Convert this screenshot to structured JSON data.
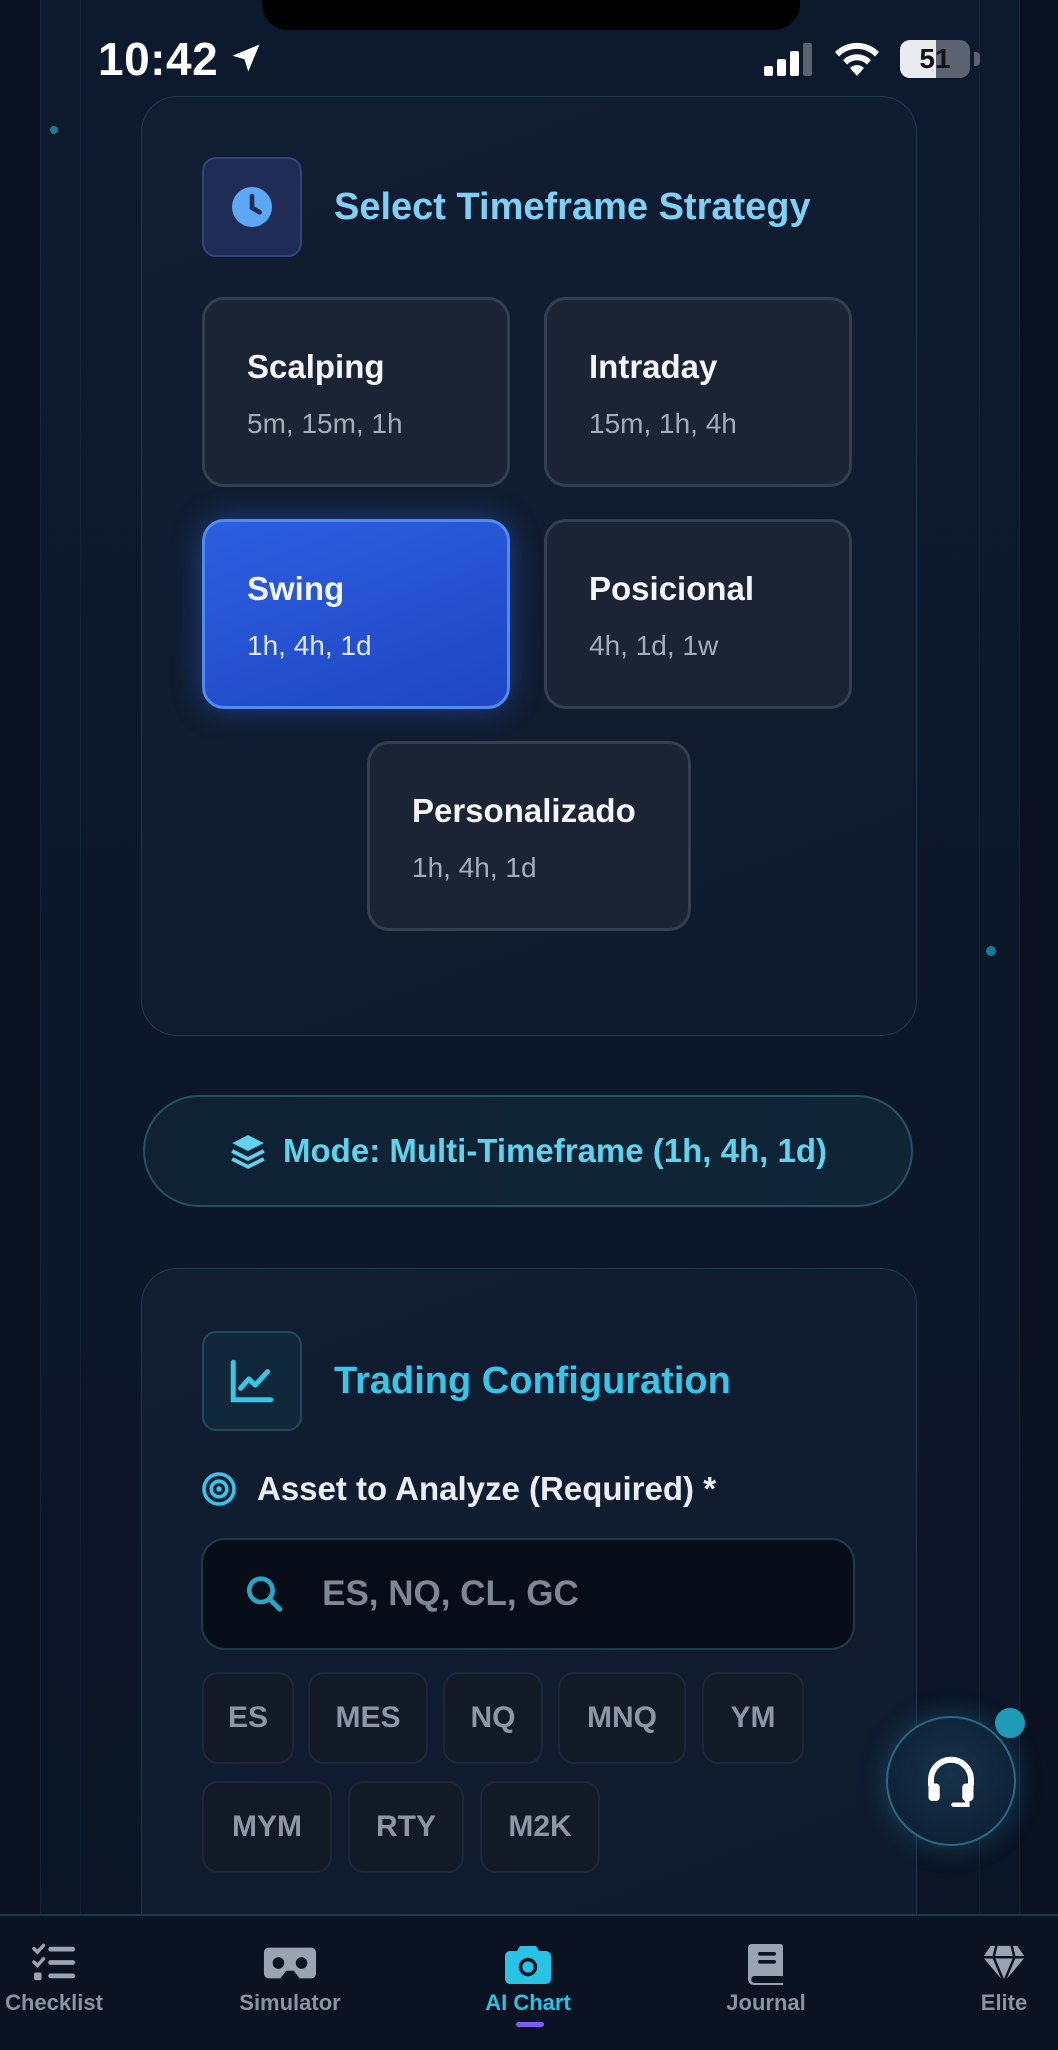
{
  "status_bar": {
    "time": "10:42",
    "battery": "51",
    "battery_level": 0.51
  },
  "timeframe": {
    "title": "Select Timeframe Strategy",
    "options": [
      {
        "name": "Scalping",
        "frames": "5m, 15m, 1h"
      },
      {
        "name": "Intraday",
        "frames": "15m, 1h, 4h"
      },
      {
        "name": "Swing",
        "frames": "1h, 4h, 1d"
      },
      {
        "name": "Posicional",
        "frames": "4h, 1d, 1w"
      },
      {
        "name": "Personalizado",
        "frames": "1h, 4h, 1d"
      }
    ],
    "selected": "Swing"
  },
  "mode": {
    "label": "Mode: Multi-Timeframe (1h, 4h, 1d)"
  },
  "config": {
    "title": "Trading Configuration",
    "asset_label": "Asset to Analyze (Required) *",
    "search_placeholder": "ES, NQ, CL, GC",
    "search_value": "",
    "chips": [
      "ES",
      "MES",
      "NQ",
      "MNQ",
      "YM",
      "MYM",
      "RTY",
      "M2K"
    ]
  },
  "tabs": [
    {
      "label": "Checklist",
      "icon": "checklist-icon"
    },
    {
      "label": "Simulator",
      "icon": "vr-headset-icon"
    },
    {
      "label": "AI Chart",
      "icon": "camera-icon",
      "active": true
    },
    {
      "label": "Journal",
      "icon": "book-icon"
    },
    {
      "label": "Elite",
      "icon": "diamond-icon"
    }
  ],
  "colors": {
    "accent": "#28c4e6",
    "selected": "#2a5bdc",
    "title_blue": "#7fd0f5"
  }
}
